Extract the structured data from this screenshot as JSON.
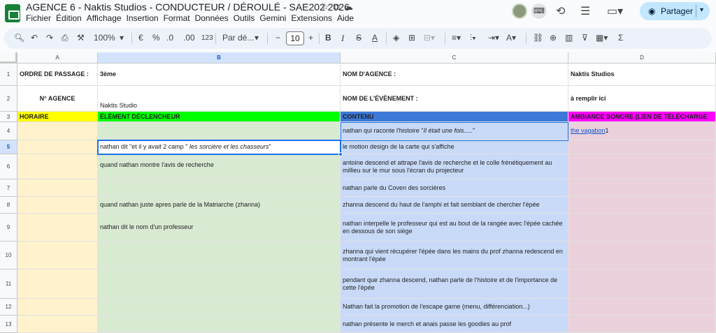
{
  "header": {
    "doc_title": "AGENCE 6 - Naktis Studios - CONDUCTEUR / DÉROULÉ - SAE202 2026",
    "menu": [
      "Fichier",
      "Édition",
      "Affichage",
      "Insertion",
      "Format",
      "Données",
      "Outils",
      "Gemini",
      "Extensions",
      "Aide"
    ],
    "share_label": "Partager"
  },
  "toolbar": {
    "zoom": "100%",
    "currency": "€",
    "percent": "%",
    "dec_less": ".0",
    "dec_more": ".00",
    "format_123": "123",
    "font_name": "Par dé...",
    "font_size": "10",
    "bold": "B",
    "italic": "I",
    "strike": "S",
    "text_color": "A",
    "sigma": "Σ"
  },
  "columns": [
    "A",
    "B",
    "C",
    "D"
  ],
  "rows": [
    "1",
    "2",
    "3",
    "4",
    "5",
    "6",
    "7",
    "8",
    "9",
    "10",
    "11",
    "12",
    "13"
  ],
  "cells": {
    "a1": "ORDRE DE PASSAGE :",
    "b1": "3ème",
    "c1": "NOM D'AGENCE :",
    "d1": "Naktis Studios",
    "a2": "N° AGENCE",
    "b2": "Naktis Studio",
    "c2": "NOM DE L'ÉVÈNEMENT :",
    "d2": "à remplir ici",
    "a3": "HORAIRE",
    "b3": "ÉLÉMENT DÉCLENCHEUR",
    "c3": "CONTENU",
    "d3": "AMBIANCE SONORE (LIEN DE TÉLÉCHARGE",
    "c4_pre": "nathan qui raconte l'histoire \"",
    "c4_it": "Il était une fois.....",
    "c4_post": "\"",
    "d4_link": "the vagabon",
    "d4_post": "1",
    "b5_pre": "nathan dit \"et il y avait 2 camp \" ",
    "b5_it": "les sorcière et les chasseurs",
    "b5_post": "\"",
    "c5": "le motion design de la carte qui s'affiche",
    "b6": "quand nathan montre l'avis de recherche",
    "c6": "antoine descend et attrape l'avis de recherche et le colle frénétiquement au millieu sur le mur sous l'écran du projecteur",
    "c7": "nathan parle du Coven des sorcières",
    "b8": "quand nathan juste apres parle de la Matriarche (zhanna)",
    "c8": "zhanna descend du haut de l'amphi et fait semblant de chercher l'épée",
    "b9": "nathan dit le nom d'un professeur",
    "c9": "nathan interpelle le professeur qui est au bout de la rangée avec l'épée cachée en dessous de son siège",
    "c10": "zhanna qui vient récupérer l'épée dans les mains du prof zhanna redescend en montrant l'épée",
    "c11": "pendant que zhanna descend, nathan parle de l'histoire et de l'importance de cette l'épée",
    "c12": "Nathan fait la promotion de l'escape game (menu, différenciation...)",
    "c13": "nathan présente le merch et anais passe les goodies au prof"
  }
}
